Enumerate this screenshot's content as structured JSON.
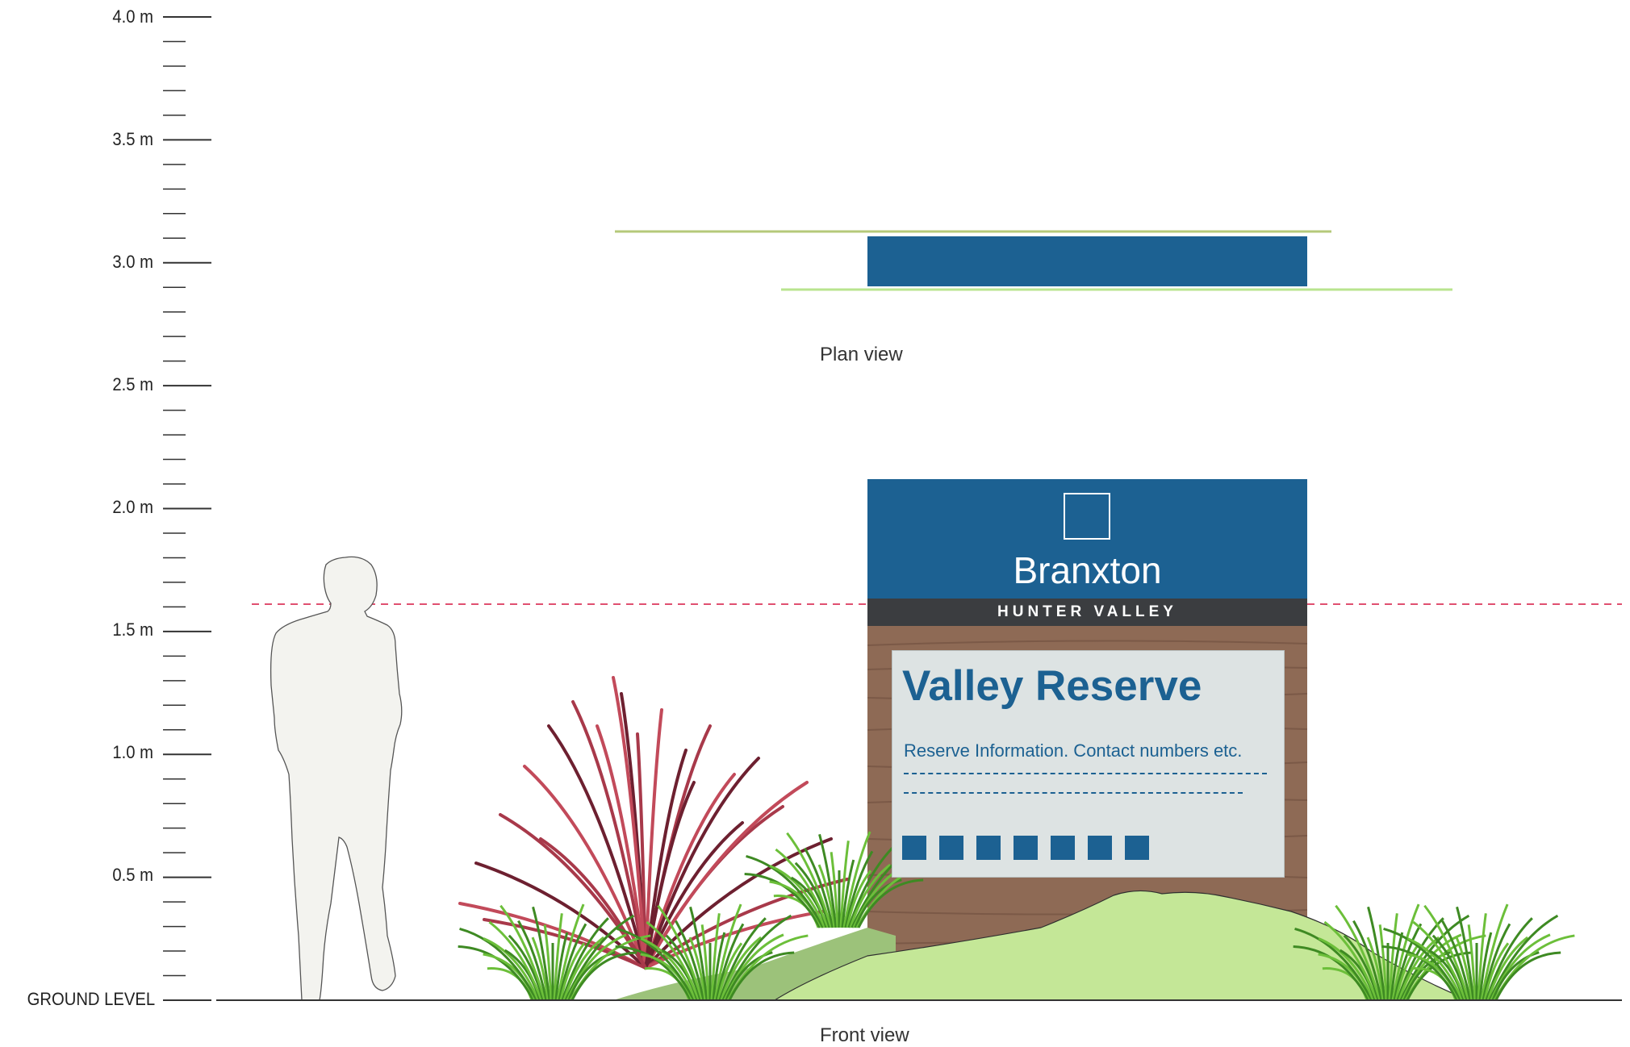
{
  "scale": {
    "unit_labels": [
      "4.0 m",
      "3.5 m",
      "3.0 m",
      "2.5 m",
      "2.0 m",
      "1.5 m",
      "1.0 m",
      "0.5 m",
      "GROUND LEVEL"
    ]
  },
  "plan_view": {
    "label": "Plan view"
  },
  "front_view": {
    "label": "Front view"
  },
  "sign": {
    "town": "Branxton",
    "region": "HUNTER VALLEY",
    "title": "Valley Reserve",
    "info": "Reserve Information.  Contact numbers etc.",
    "square_count": 7
  },
  "colors": {
    "sign_blue": "#1c6192",
    "band_dark": "#3b3d40",
    "timber": "#8e6a55",
    "mound_green": "#c4e797",
    "eye_line": "#e05070"
  }
}
